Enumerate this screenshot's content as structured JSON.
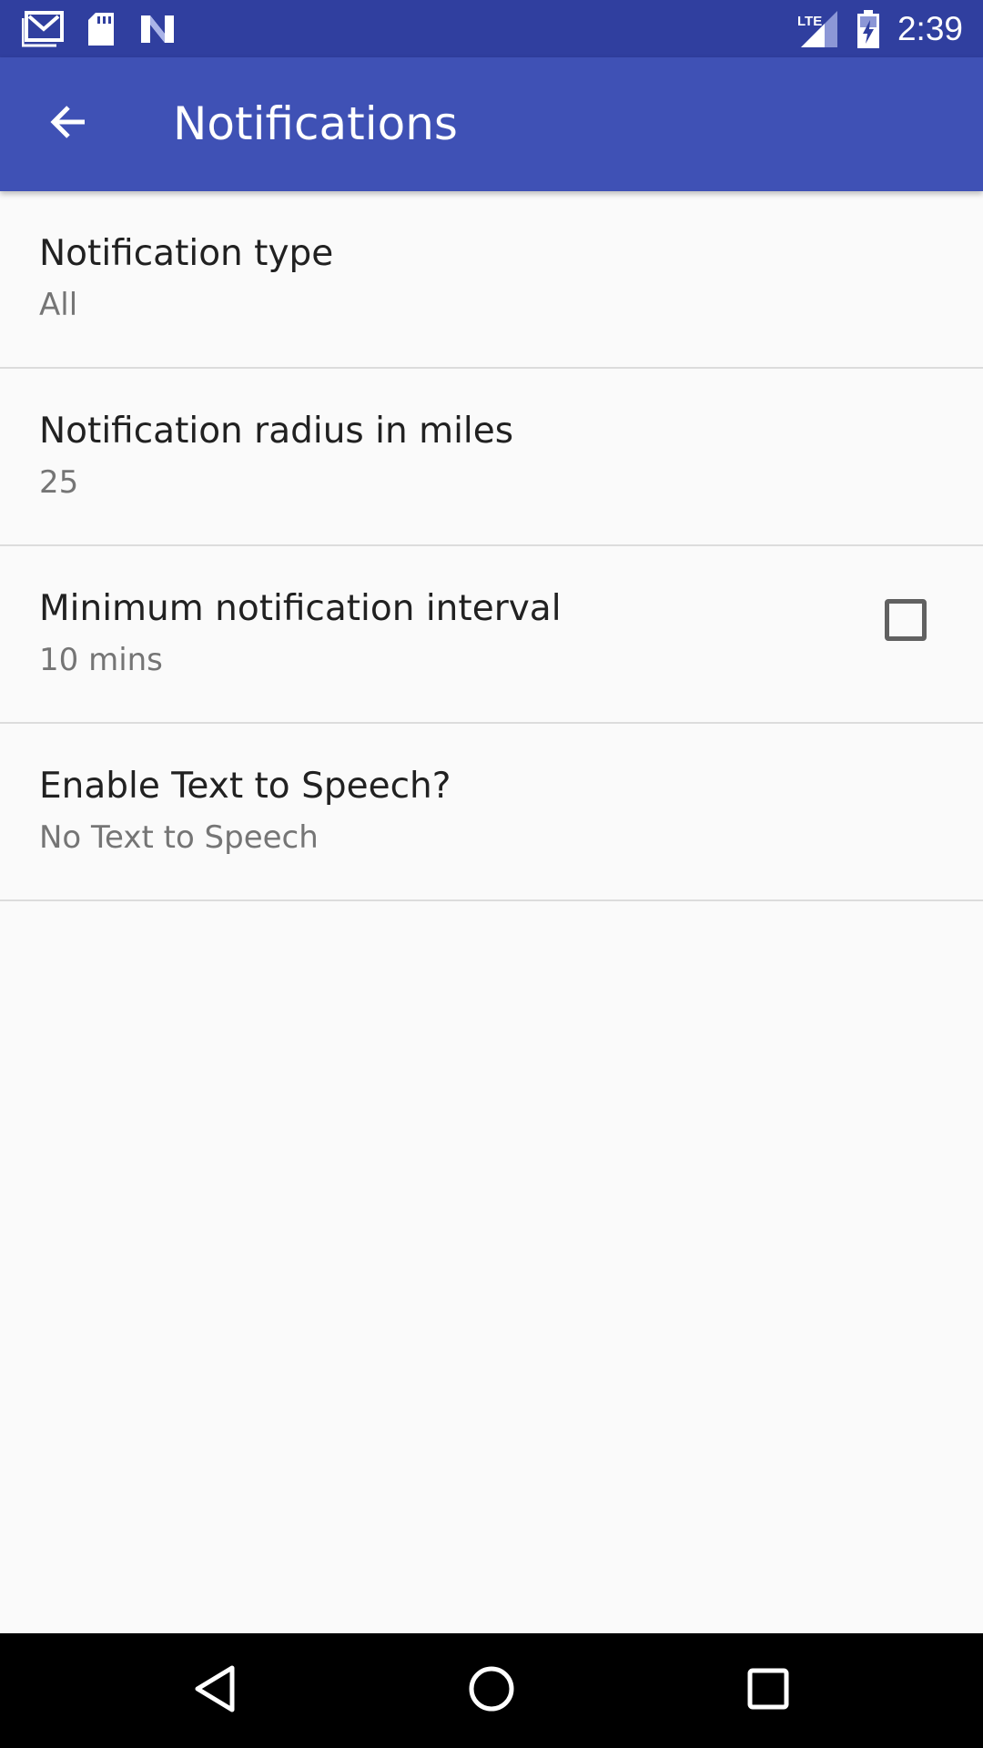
{
  "status_bar": {
    "time": "2:39",
    "network_label": "LTE",
    "left_icons": [
      "gmail-icon",
      "sd-card-icon",
      "n-app-icon"
    ],
    "right_icons": [
      "signal-icon",
      "battery-charging-icon"
    ]
  },
  "app_bar": {
    "title": "Notifications",
    "back_icon": "arrow-back-icon"
  },
  "preferences": [
    {
      "title": "Notification type",
      "summary": "All"
    },
    {
      "title": "Notification radius in miles",
      "summary": "25"
    },
    {
      "title": "Minimum notification interval",
      "summary": "10 mins"
    },
    {
      "title": "Enable Text to Speech?",
      "summary": "No Text to Speech",
      "checked": false
    }
  ],
  "nav_bar": {
    "icons": [
      "back-triangle-icon",
      "home-circle-icon",
      "recents-square-icon"
    ]
  },
  "colors": {
    "status_bar": "#303f9f",
    "app_bar": "#3f51b5",
    "background": "#fafafa"
  }
}
